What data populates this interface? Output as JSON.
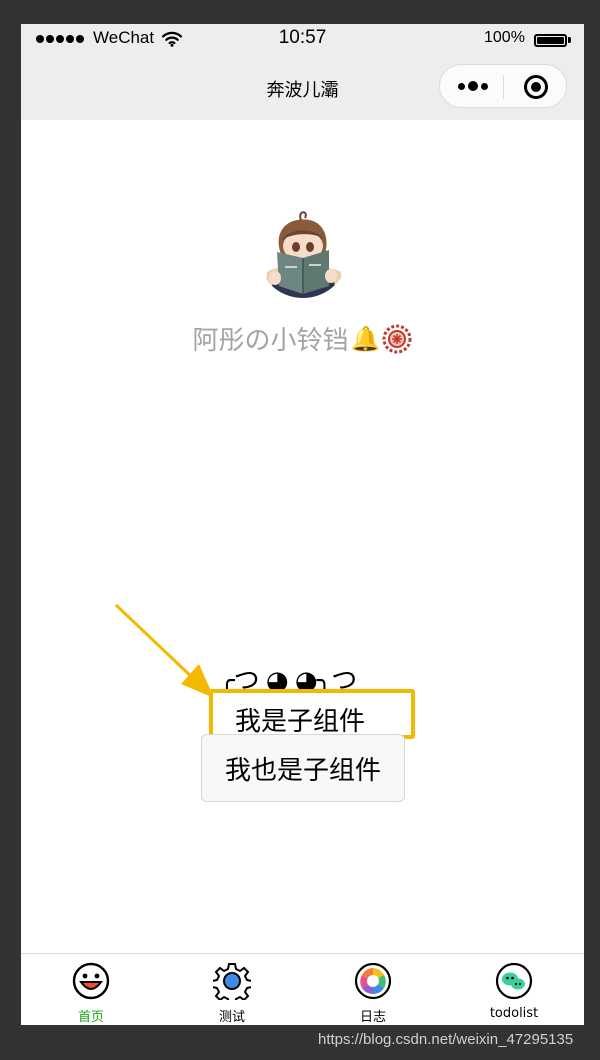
{
  "status_bar": {
    "carrier": "WeChat",
    "time": "10:57",
    "battery_percent": "100%",
    "signal_icon": "signal-dots-icon",
    "wifi_icon": "wifi-icon",
    "battery_icon": "battery-icon",
    "battery_level": 1.0
  },
  "nav_bar": {
    "title": "奔波儿灞",
    "more_icon": "more-dots-icon",
    "close_icon": "target-circle-icon"
  },
  "profile": {
    "avatar": "avatar-anime-girl-reading-book",
    "nickname": "阿彤の小铃铛🔔🔯",
    "nickname_text": "阿彤の小铃铛",
    "emoji_1": "🔔",
    "emoji_2_icon": "red-gear-emblem-icon"
  },
  "annotation": {
    "arrow_icon": "arrow-down-right-icon",
    "arrow_color": "#f5b800",
    "highlight_color": "#f5b800"
  },
  "child": {
    "kaomoji": "╭つ ◕ ◕╮つ",
    "label": "我是子组件"
  },
  "child_button": {
    "label": "我也是子组件"
  },
  "tab_bar": {
    "active_color": "#1aad19",
    "tabs": [
      {
        "label": "首页",
        "icon": "smiley-face-icon",
        "active": true
      },
      {
        "label": "测试",
        "icon": "gear-icon",
        "active": false
      },
      {
        "label": "日志",
        "icon": "camera-aperture-icon",
        "active": false
      },
      {
        "label": "todolist",
        "icon": "chat-bubbles-icon",
        "active": false
      }
    ]
  },
  "watermark": "https://blog.csdn.net/weixin_47295135"
}
